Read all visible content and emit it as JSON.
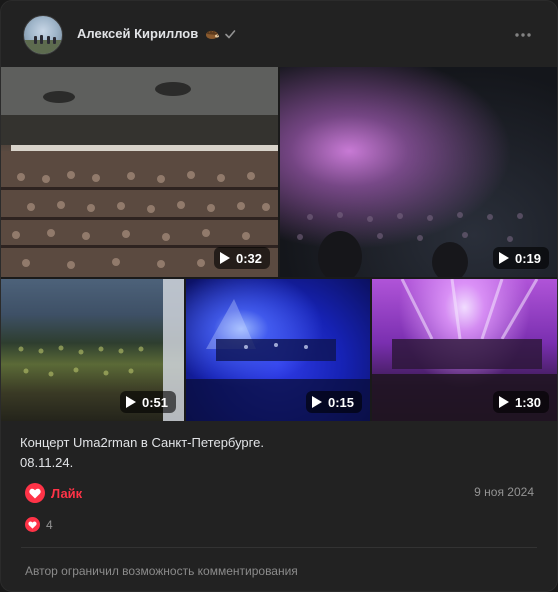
{
  "author": {
    "name": "Алексей Кириллов",
    "emoji_icon": "hedgehog-icon",
    "verified_icon": "checkmark-icon"
  },
  "header": {
    "more_icon": "more-dots-icon"
  },
  "media": [
    {
      "duration": "0:32",
      "icon": "play-icon"
    },
    {
      "duration": "0:19",
      "icon": "play-icon"
    },
    {
      "duration": "0:51",
      "icon": "play-icon"
    },
    {
      "duration": "0:15",
      "icon": "play-icon"
    },
    {
      "duration": "1:30",
      "icon": "play-icon"
    }
  ],
  "post": {
    "text_line1": "Концерт Uma2rman в Санкт-Петербурге.",
    "text_line2": "08.11.24."
  },
  "actions": {
    "like_label": "Лайк",
    "like_icon": "heart-icon",
    "date": "9 ноя 2024"
  },
  "reactions": {
    "count": "4",
    "icon": "heart-icon"
  },
  "comments": {
    "restricted_note": "Автор ограничил возможность комментирования"
  },
  "colors": {
    "background": "#222222",
    "accent_like": "#ff3347",
    "text_primary": "#e1e3e6",
    "text_secondary": "#939393"
  }
}
